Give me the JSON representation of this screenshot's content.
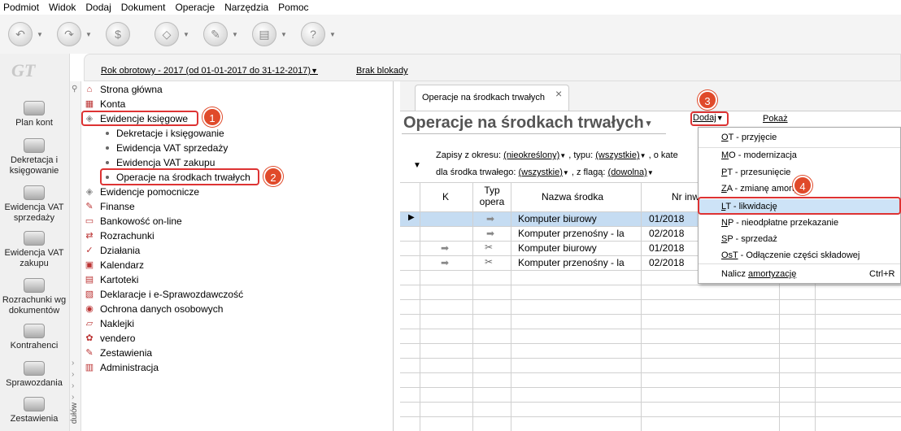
{
  "menubar": [
    "Podmiot",
    "Widok",
    "Dodaj",
    "Dokument",
    "Operacje",
    "Narzędzia",
    "Pomoc"
  ],
  "left_nav": [
    {
      "label": "Plan kont"
    },
    {
      "label": "Dekretacja i księgowanie"
    },
    {
      "label": "Ewidencja VAT sprzedaży"
    },
    {
      "label": "Ewidencja VAT zakupu"
    },
    {
      "label": "Rozrachunki wg dokumentów"
    },
    {
      "label": "Kontrahenci"
    },
    {
      "label": "Sprawozdania"
    },
    {
      "label": "Zestawienia"
    }
  ],
  "logo": "GT",
  "modules_label": "dułów",
  "topbar": {
    "year": "Rok obrotowy - 2017  (od 01-01-2017 do 31-12-2017)",
    "lock": "Brak blokady"
  },
  "tree": {
    "items": [
      "Strona główna",
      "Konta",
      "Ewidencje księgowe",
      "Dekretacje i księgowanie",
      "Ewidencja VAT sprzedaży",
      "Ewidencja VAT zakupu",
      "Operacje na środkach trwałych",
      "Ewidencje pomocnicze",
      "Finanse",
      "Bankowość on-line",
      "Rozrachunki",
      "Działania",
      "Kalendarz",
      "Kartoteki",
      "Deklaracje i e-Sprawozdawczość",
      "Ochrona danych osobowych",
      "Naklejki",
      "vendero",
      "Zestawienia",
      "Administracja"
    ]
  },
  "badges": [
    "1",
    "2",
    "3",
    "4"
  ],
  "tab": {
    "label": "Operacje na środkach trwałych",
    "close": "×"
  },
  "page": {
    "title": "Operacje na środkach trwałych",
    "dodaj": "Dodaj",
    "pokaz": "Pokaż"
  },
  "filters": {
    "okres_label": "Zapisy z okresu:",
    "okres": "(nieokreślony)",
    "typ_label": ", typu:",
    "typ": "(wszystkie)",
    "kate_label": ", o kate",
    "srodek_label": "dla środka trwałego:",
    "srodek": "(wszystkie)",
    "flaga_label": ", z flagą:",
    "flaga": "(dowolna)"
  },
  "grid": {
    "headers": [
      "K",
      "Typ opera",
      "Nazwa środka",
      "Nr inw"
    ],
    "rows": [
      {
        "name": "Komputer biurowy",
        "nr": "01/2018",
        "selected": true
      },
      {
        "name": "Komputer przenośny - la",
        "nr": "02/2018"
      },
      {
        "name": "Komputer biurowy",
        "nr": "01/2018"
      },
      {
        "name": "Komputer przenośny - la",
        "nr": "02/2018"
      }
    ]
  },
  "dodaj_menu": [
    {
      "key": "O",
      "rest": "T - przyjęcie"
    },
    {
      "key": "M",
      "rest": "O - modernizacja"
    },
    {
      "key": "P",
      "rest": "T - przesunięcie"
    },
    {
      "key": "Z",
      "rest": "A - zmianę amorty"
    },
    {
      "key": "L",
      "rest": "T - likwidację"
    },
    {
      "key": "N",
      "rest": "P - nieodpłatne przekazanie"
    },
    {
      "key": "S",
      "rest": "P - sprzedaż"
    },
    {
      "key": "OsT",
      "rest": " - Odłączenie części składowej"
    },
    {
      "key": "Nalicz ",
      "rest": "amortyzację",
      "shortcut": "Ctrl+R"
    }
  ]
}
